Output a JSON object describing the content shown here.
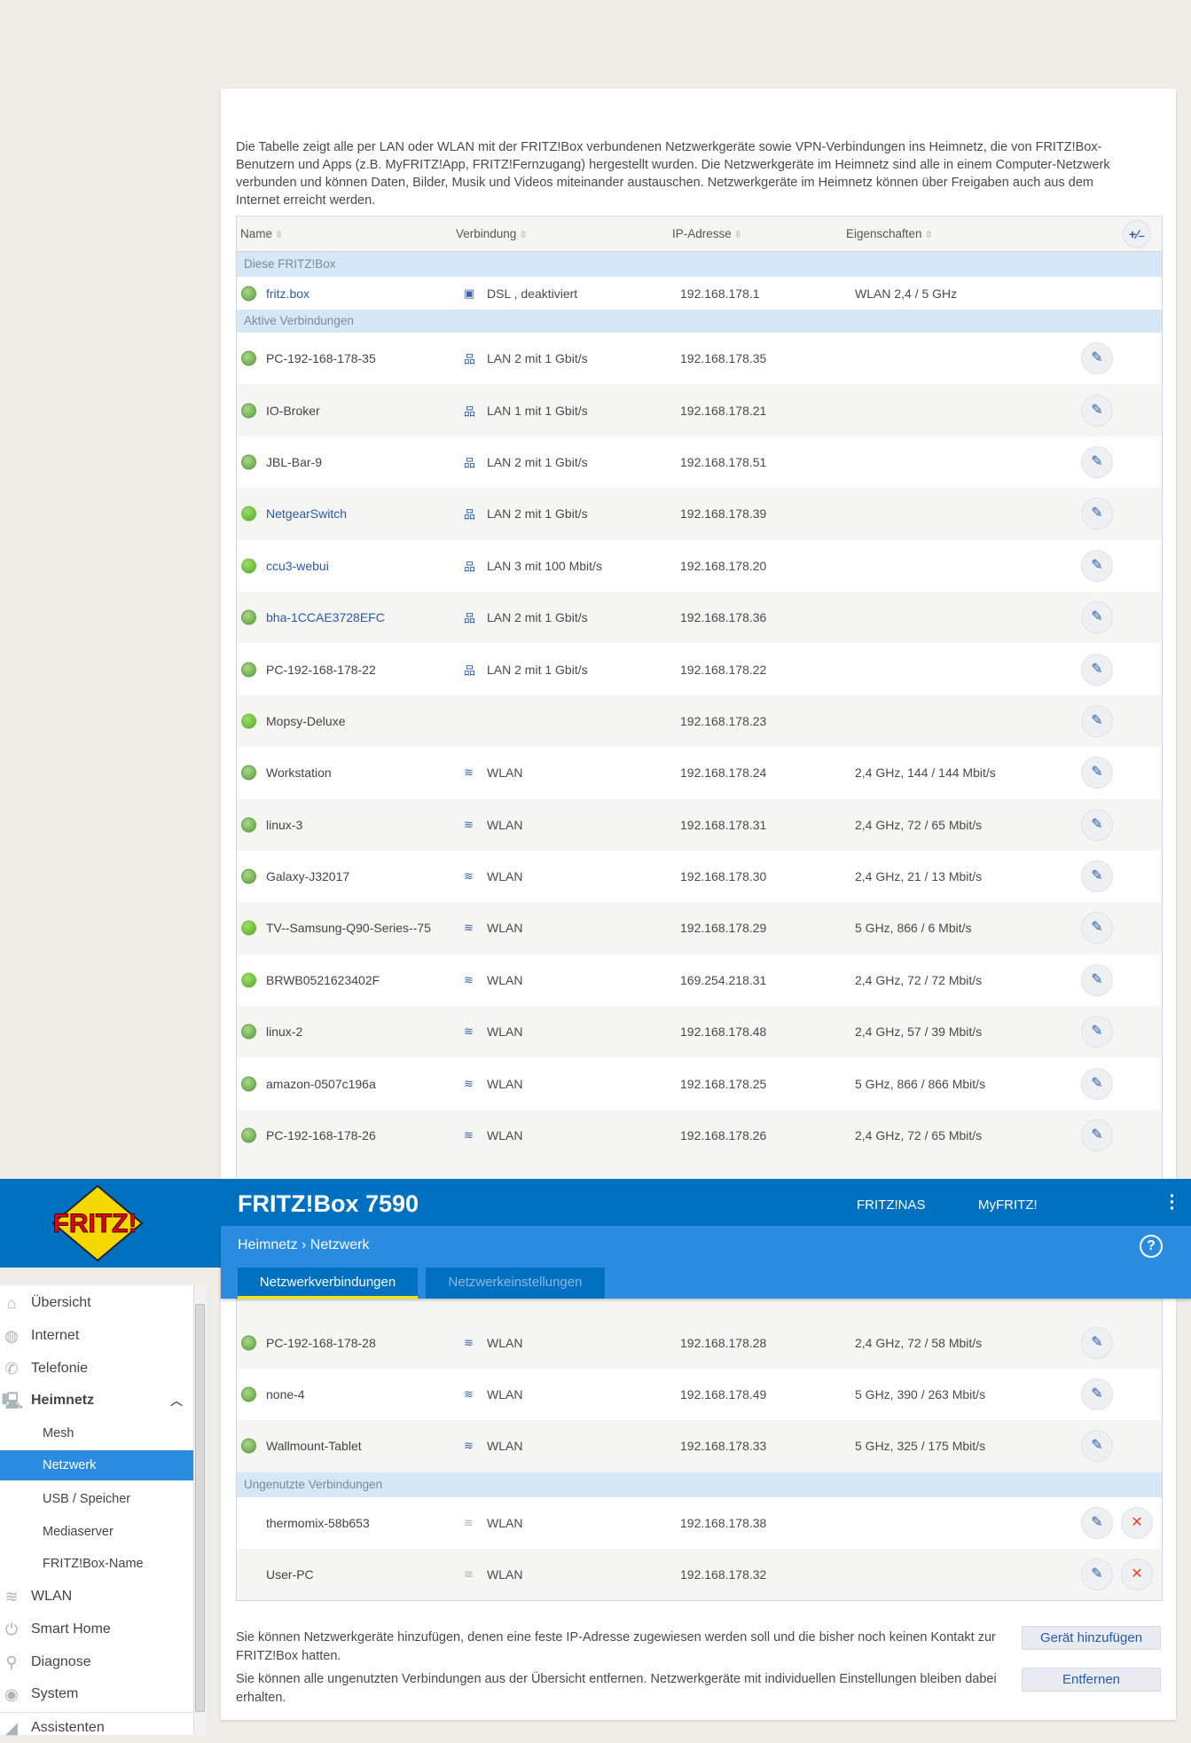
{
  "header": {
    "title": "FRITZ!Box 7590",
    "links": [
      "FRITZ!NAS",
      "MyFRITZ!"
    ],
    "breadcrumb": "Heimnetz › Netzwerk",
    "tabs": [
      "Netzwerkverbindungen",
      "Netzwerkeinstellungen"
    ],
    "logo_text": "FRITZ!"
  },
  "intro": "Die Tabelle zeigt alle per LAN oder WLAN mit der FRITZ!Box verbundenen Netzwerkgeräte sowie VPN-Verbindungen ins Heimnetz, die von FRITZ!Box-Benutzern und Apps (z.B. MyFRITZ!App, FRITZ!Fernzugang) hergestellt wurden. Die Netzwerkgeräte im Heimnetz sind alle in einem Computer-Netzwerk verbunden und können Daten, Bilder, Musik und Videos miteinander austauschen. Netzwerkgeräte im Heimnetz können über Freigaben auch aus dem Internet erreicht werden.",
  "table": {
    "columns": [
      "Name",
      "Verbindung",
      "IP-Adresse",
      "Eigenschaften"
    ],
    "sections": [
      "Diese FRITZ!Box",
      "Aktive Verbindungen",
      "Ungenutzte Verbindungen"
    ],
    "fritzbox": {
      "name": "fritz.box",
      "conn": "DSL , deaktiviert",
      "ip": "192.168.178.1",
      "props": "WLAN 2,4 / 5 GHz"
    },
    "active": [
      {
        "name": "PC-192-168-178-35",
        "status": "globe",
        "type": "lan",
        "conn": "LAN 2 mit 1 Gbit/s",
        "ip": "192.168.178.35",
        "props": ""
      },
      {
        "name": "IO-Broker",
        "status": "globe",
        "type": "lan",
        "conn": "LAN 1 mit 1 Gbit/s",
        "ip": "192.168.178.21",
        "props": ""
      },
      {
        "name": "JBL-Bar-9",
        "status": "globe",
        "type": "lan",
        "conn": "LAN 2 mit 1 Gbit/s",
        "ip": "192.168.178.51",
        "props": ""
      },
      {
        "name": "NetgearSwitch",
        "status": "dot",
        "link": true,
        "type": "lan",
        "conn": "LAN 2 mit 1 Gbit/s",
        "ip": "192.168.178.39",
        "props": ""
      },
      {
        "name": "ccu3-webui",
        "status": "dot",
        "link": true,
        "type": "lan",
        "conn": "LAN 3 mit 100 Mbit/s",
        "ip": "192.168.178.20",
        "props": ""
      },
      {
        "name": "bha-1CCAE3728EFC",
        "status": "globe",
        "link": true,
        "type": "lan",
        "conn": "LAN 2 mit 1 Gbit/s",
        "ip": "192.168.178.36",
        "props": ""
      },
      {
        "name": "PC-192-168-178-22",
        "status": "globe",
        "type": "lan",
        "conn": "LAN 2 mit 1 Gbit/s",
        "ip": "192.168.178.22",
        "props": ""
      },
      {
        "name": "Mopsy-Deluxe",
        "status": "dot",
        "type": "",
        "conn": "",
        "ip": "192.168.178.23",
        "props": ""
      },
      {
        "name": "Workstation",
        "status": "globe",
        "type": "wlan",
        "conn": "WLAN",
        "ip": "192.168.178.24",
        "props": "2,4 GHz, 144 / 144 Mbit/s"
      },
      {
        "name": "linux-3",
        "status": "globe",
        "type": "wlan",
        "conn": "WLAN",
        "ip": "192.168.178.31",
        "props": "2,4 GHz, 72 / 65 Mbit/s"
      },
      {
        "name": "Galaxy-J32017",
        "status": "globe",
        "type": "wlan",
        "conn": "WLAN",
        "ip": "192.168.178.30",
        "props": "2,4 GHz, 21 / 13 Mbit/s"
      },
      {
        "name": "TV--Samsung-Q90-Series--75",
        "status": "dot",
        "type": "wlan",
        "conn": "WLAN",
        "ip": "192.168.178.29",
        "props": "5 GHz, 866 / 6 Mbit/s"
      },
      {
        "name": "BRWB0521623402F",
        "status": "dot",
        "type": "wlan",
        "conn": "WLAN",
        "ip": "169.254.218.31",
        "props": "2,4 GHz, 72 / 72 Mbit/s"
      },
      {
        "name": "linux-2",
        "status": "globe",
        "type": "wlan",
        "conn": "WLAN",
        "ip": "192.168.178.48",
        "props": "2,4 GHz, 57 / 39 Mbit/s"
      },
      {
        "name": "amazon-0507c196a",
        "status": "globe",
        "type": "wlan",
        "conn": "WLAN",
        "ip": "192.168.178.25",
        "props": "5 GHz, 866 / 866 Mbit/s"
      },
      {
        "name": "PC-192-168-178-26",
        "status": "globe",
        "type": "wlan",
        "conn": "WLAN",
        "ip": "192.168.178.26",
        "props": "2,4 GHz, 72 / 65 Mbit/s"
      }
    ],
    "active_after": [
      {
        "name": "PC-192-168-178-28",
        "status": "globe",
        "type": "wlan",
        "conn": "WLAN",
        "ip": "192.168.178.28",
        "props": "2,4 GHz, 72 / 58 Mbit/s"
      },
      {
        "name": "none-4",
        "status": "globe",
        "type": "wlan",
        "conn": "WLAN",
        "ip": "192.168.178.49",
        "props": "5 GHz, 390 / 263 Mbit/s"
      },
      {
        "name": "Wallmount-Tablet",
        "status": "globe",
        "type": "wlan",
        "conn": "WLAN",
        "ip": "192.168.178.33",
        "props": "5 GHz, 325 / 175 Mbit/s"
      }
    ],
    "unused": [
      {
        "name": "thermomix-58b653",
        "status": "",
        "type": "wlan-off",
        "conn": "WLAN",
        "ip": "192.168.178.38",
        "props": ""
      },
      {
        "name": "User-PC",
        "status": "",
        "type": "wlan-off",
        "conn": "WLAN",
        "ip": "192.168.178.32",
        "props": ""
      }
    ]
  },
  "footer": {
    "add_text": "Sie können Netzwerkgeräte hinzufügen, denen eine feste IP-Adresse zugewiesen werden soll und die bisher noch keinen Kontakt zur FRITZ!Box hatten.",
    "add_button": "Gerät hinzufügen",
    "remove_text": "Sie können alle ungenutzten Verbindungen aus der Übersicht entfernen. Netzwerkgeräte mit individuellen Einstellungen bleiben dabei erhalten.",
    "remove_button": "Entfernen"
  },
  "sidebar": [
    {
      "label": "Übersicht",
      "icon": "home-icon",
      "glyph": "⌂"
    },
    {
      "label": "Internet",
      "icon": "globe-icon",
      "glyph": "◍"
    },
    {
      "label": "Telefonie",
      "icon": "phone-icon",
      "glyph": "✆"
    },
    {
      "label": "Heimnetz",
      "icon": "network-icon",
      "glyph": "🖳",
      "bold": true,
      "expanded": true
    },
    {
      "label": "Mesh",
      "sub": true
    },
    {
      "label": "Netzwerk",
      "sub": true,
      "selected": true
    },
    {
      "label": "USB / Speicher",
      "sub": true
    },
    {
      "label": "Mediaserver",
      "sub": true
    },
    {
      "label": "FRITZ!Box-Name",
      "sub": true
    },
    {
      "label": "WLAN",
      "icon": "wifi-icon",
      "glyph": "≋"
    },
    {
      "label": "Smart Home",
      "icon": "smart-home-icon",
      "glyph": "⏻"
    },
    {
      "label": "Diagnose",
      "icon": "diagnose-icon",
      "glyph": "⚲"
    },
    {
      "label": "System",
      "icon": "system-icon",
      "glyph": "◉"
    },
    {
      "label": "Assistenten",
      "icon": "wizard-icon",
      "glyph": "◢"
    }
  ]
}
